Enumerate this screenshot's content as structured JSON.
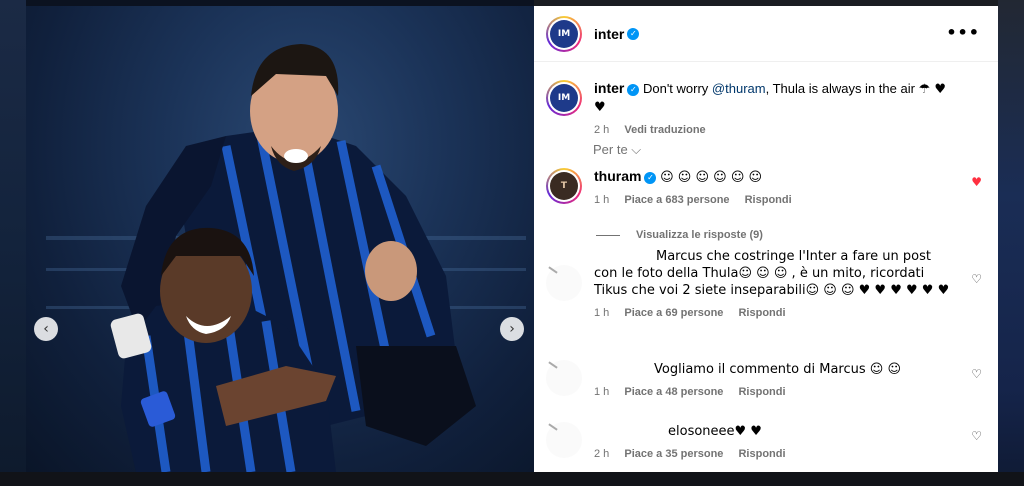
{
  "post": {
    "username": "inter",
    "more_label": "•••",
    "caption": {
      "username": "inter",
      "text_before": "Don't worry ",
      "mention": "@thuram",
      "text_after": ", Thula is always in the air",
      "emojis": "☂ ♥ ♥",
      "time": "2 h",
      "translate": "Vedi traduzione"
    },
    "for_you": "Per te ⌵"
  },
  "photo": {
    "prev_icon": "‹",
    "next_icon": "›"
  },
  "comments": [
    {
      "username": "thuram",
      "text": "☺ ☺ ☺ ☺ ☺ ☺",
      "time": "1 h",
      "likes": "Piace a 683 persone",
      "reply": "Rispondi",
      "liked": true,
      "view_replies": "Visualizza le risposte (9)"
    },
    {
      "username": "",
      "text": "Marcus che costringe l'Inter a fare un post con le foto della Thula☺ ☺ ☺ , è un mito, ricordati Tikus che voi 2 siete inseparabili☺ ☺ ☺ ♥ ♥ ♥ ♥ ♥ ♥",
      "time": "1 h",
      "likes": "Piace a 69 persone",
      "reply": "Rispondi",
      "liked": false
    },
    {
      "username": "",
      "text": "Vogliamo il commento di Marcus ☺ ☺",
      "time": "1 h",
      "likes": "Piace a 48 persone",
      "reply": "Rispondi",
      "liked": false
    },
    {
      "username": "",
      "text": "elosoneee♥ ♥",
      "time": "2 h",
      "likes": "Piace a 35 persone",
      "reply": "Rispondi",
      "liked": false
    }
  ],
  "icons": {
    "verified": "✓",
    "heart_filled": "♥",
    "heart_empty": "♡"
  },
  "colors": {
    "accent": "#0095f6",
    "like": "#ff3040",
    "inter_blue": "#1e3a8a"
  }
}
